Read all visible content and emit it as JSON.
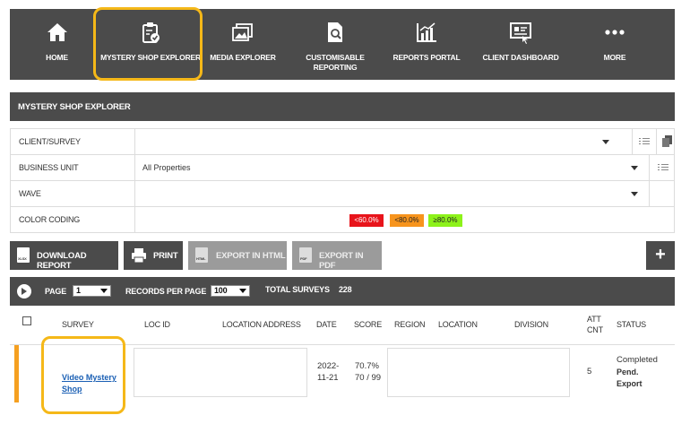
{
  "nav": {
    "items": [
      {
        "label": "HOME",
        "icon": "home-icon"
      },
      {
        "label": "MYSTERY SHOP EXPLORER",
        "icon": "clipboard-check-icon"
      },
      {
        "label": "MEDIA EXPLORER",
        "icon": "images-icon"
      },
      {
        "label": "CUSTOMISABLE\nREPORTING",
        "icon": "document-search-icon"
      },
      {
        "label": "REPORTS PORTAL",
        "icon": "bar-chart-icon"
      },
      {
        "label": "CLIENT DASHBOARD",
        "icon": "dashboard-icon"
      },
      {
        "label": "MORE",
        "icon": "more-dots-icon"
      }
    ],
    "active": "MYSTERY SHOP EXPLORER"
  },
  "section_title": "MYSTERY SHOP EXPLORER",
  "filters": {
    "client_survey": {
      "label": "CLIENT/SURVEY",
      "value": ""
    },
    "business_unit": {
      "label": "BUSINESS UNIT",
      "value": "All Properties"
    },
    "wave": {
      "label": "WAVE",
      "value": ""
    },
    "color_coding": {
      "label": "COLOR CODING",
      "swatches": [
        {
          "text": "<60.0%",
          "color": "#e8141b"
        },
        {
          "text": "<80.0%",
          "color": "#f7941d"
        },
        {
          "text": "≥80.0%",
          "color": "#8df21a"
        }
      ]
    }
  },
  "actions": {
    "download": "DOWNLOAD REPORT",
    "print": "PRINT",
    "export_html": "EXPORT IN HTML",
    "export_pdf": "EXPORT IN PDF",
    "add": "+"
  },
  "pager": {
    "page_label": "PAGE",
    "page_value": "1",
    "records_label": "RECORDS PER PAGE",
    "records_value": "100",
    "total_label": "TOTAL SURVEYS",
    "total_value": "228"
  },
  "table": {
    "columns": [
      "SURVEY",
      "LOC ID",
      "LOCATION ADDRESS",
      "DATE",
      "SCORE",
      "REGION",
      "LOCATION",
      "DIVISION",
      "ATT\nCNT",
      "STATUS"
    ],
    "rows": [
      {
        "survey": "Video Mystery\nShop",
        "loc_id": "",
        "location_address": "",
        "date": "2022-\n11-21",
        "score": "70.7%\n70 / 99",
        "region": "",
        "location": "",
        "division": "",
        "att_cnt": "5",
        "status": "Completed",
        "status_flags": "Pend.\nExport"
      }
    ]
  },
  "colors": {
    "nav_bg": "#4b4b4b",
    "highlight": "#f5b818",
    "row_marker": "#f5a020",
    "link": "#1a5fb4"
  }
}
